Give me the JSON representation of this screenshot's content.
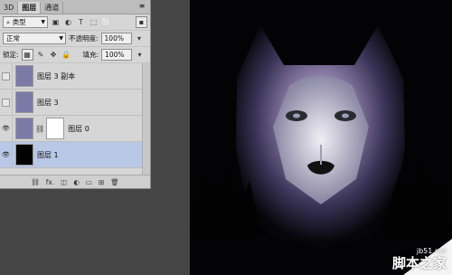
{
  "panel": {
    "tabs": [
      {
        "label": "3D"
      },
      {
        "label": "图层",
        "active": true
      },
      {
        "label": "通道"
      }
    ],
    "filter_label": "类型",
    "blend_mode": "正常",
    "opacity_label": "不透明度:",
    "opacity_value": "100%",
    "lock_label": "锁定:",
    "fill_label": "填充:",
    "fill_value": "100%",
    "layers": [
      {
        "name": "图层 3 副本",
        "visible": false,
        "selected": false,
        "thumb": "wolf"
      },
      {
        "name": "图层 3",
        "visible": false,
        "selected": false,
        "thumb": "wolf"
      },
      {
        "name": "图层 0",
        "visible": true,
        "selected": false,
        "thumb": "wolf",
        "has_mask": true
      },
      {
        "name": "图层 1",
        "visible": true,
        "selected": true,
        "thumb": "black"
      }
    ]
  },
  "watermark": {
    "line1": "jb51.net",
    "line2": "脚本之家"
  }
}
